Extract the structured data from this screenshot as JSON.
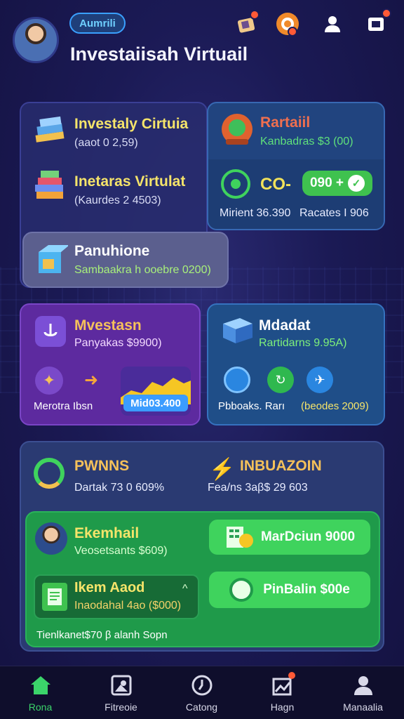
{
  "header": {
    "badge": "Aumrili",
    "title": "Investaiisah Virtuail",
    "icons": [
      "gift-icon",
      "coin-icon",
      "profile-icon",
      "wallet-icon"
    ]
  },
  "card_portfolio": {
    "item1_title": "Investaly Cirtuia",
    "item1_sub": "(aaot 0 2,59)",
    "item2_title": "Inetaras Virtulat",
    "item2_sub": "(Kaurdes 2 4503)"
  },
  "card_rartuil": {
    "title": "Rartaiil",
    "sub": "Kanbadras $3 (00)",
    "amount": "CO-",
    "pill": "090 +",
    "foot_left": "Mirient 36.390",
    "foot_right": "Racates I 906"
  },
  "card_panuhione": {
    "title": "Panuhione",
    "sub": "Sambaakra h ooebre 0200)"
  },
  "card_mvestasn": {
    "title": "Mvestasn",
    "sub": "Panyakas $9900)",
    "label": "Merotra Ibsn",
    "chart_value": "Mid03.400"
  },
  "card_mdadat": {
    "title": "Mdadat",
    "sub": "Rartidarns 9.95A)",
    "label_left": "Pbboaks. Rarı",
    "label_right": "(beodes 2009)"
  },
  "card_summary": {
    "left_title": "PWNNS",
    "left_sub": "Dartak 73 0 609%",
    "right_title": "INBUAZOIN",
    "right_sub": "Fea/ns 3aβ$ 29 603"
  },
  "card_green": {
    "person_title": "Ekemhail",
    "person_sub": "Veosetsants $609)",
    "ticket_title": "Ikem Aaod",
    "ticket_sub": "Inaodahal 4ao ($000)",
    "btn1": "MarDciun 9000",
    "btn2": "PinBalin $00e",
    "footer": "Tienlkanet$70 β alanh Sopn"
  },
  "nav": {
    "items": [
      {
        "label": "Rona",
        "icon": "home-icon",
        "color": "#3bd46a"
      },
      {
        "label": "Fitreoie",
        "icon": "photo-icon",
        "color": "#d8d8e8"
      },
      {
        "label": "Catong",
        "icon": "clock-icon",
        "color": "#d8d8e8"
      },
      {
        "label": "Hagn",
        "icon": "chart-icon",
        "color": "#d8d8e8"
      },
      {
        "label": "Manaalia",
        "icon": "user-icon",
        "color": "#d8d8e8"
      }
    ]
  }
}
